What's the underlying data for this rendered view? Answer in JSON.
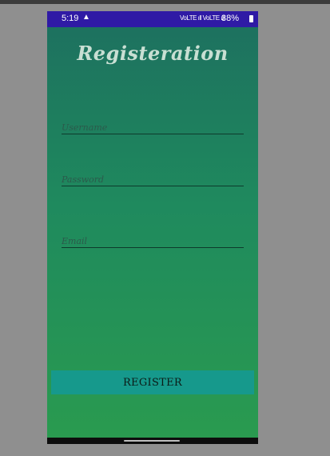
{
  "status_bar": {
    "time": "5:19",
    "warning_glyph": "▲",
    "signal_text": "VoLTE ıll VoLTE ıll",
    "battery_text": "38%",
    "battery_icon": "battery-icon"
  },
  "screen": {
    "title": "Registeration"
  },
  "form": {
    "username": {
      "value": "",
      "placeholder": "Username"
    },
    "password": {
      "value": "",
      "placeholder": "Password"
    },
    "email": {
      "value": "",
      "placeholder": "Email"
    }
  },
  "register_button": {
    "label": "REGISTER"
  },
  "colors": {
    "status_bar": "#2f1aa5",
    "gradient_top": "#1d6f5f",
    "gradient_bottom": "#2a9b4f",
    "button": "#16998c"
  }
}
